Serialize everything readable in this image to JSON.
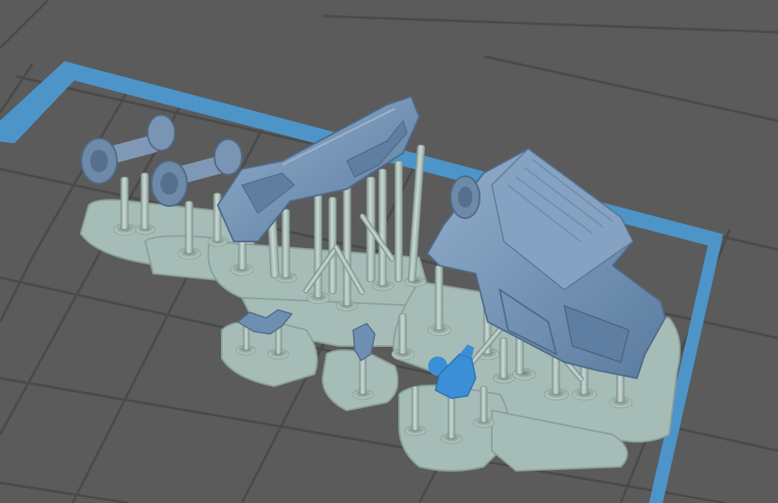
{
  "viewport": {
    "background": "#5b5b5b",
    "grid_line_color": "#4a4a4a",
    "build_plate_border_color": "#4d94c8",
    "support_color": "#b2c6c0",
    "raft_color": "#a6bcb6",
    "model_color": "#6f8fb2",
    "selected_model_color": "#3b8fd6"
  },
  "icons": {
    "tire": "tire-icon",
    "jeep_body": "jeep-body-icon",
    "chassis": "chassis-icon",
    "figure": "figure-icon"
  }
}
